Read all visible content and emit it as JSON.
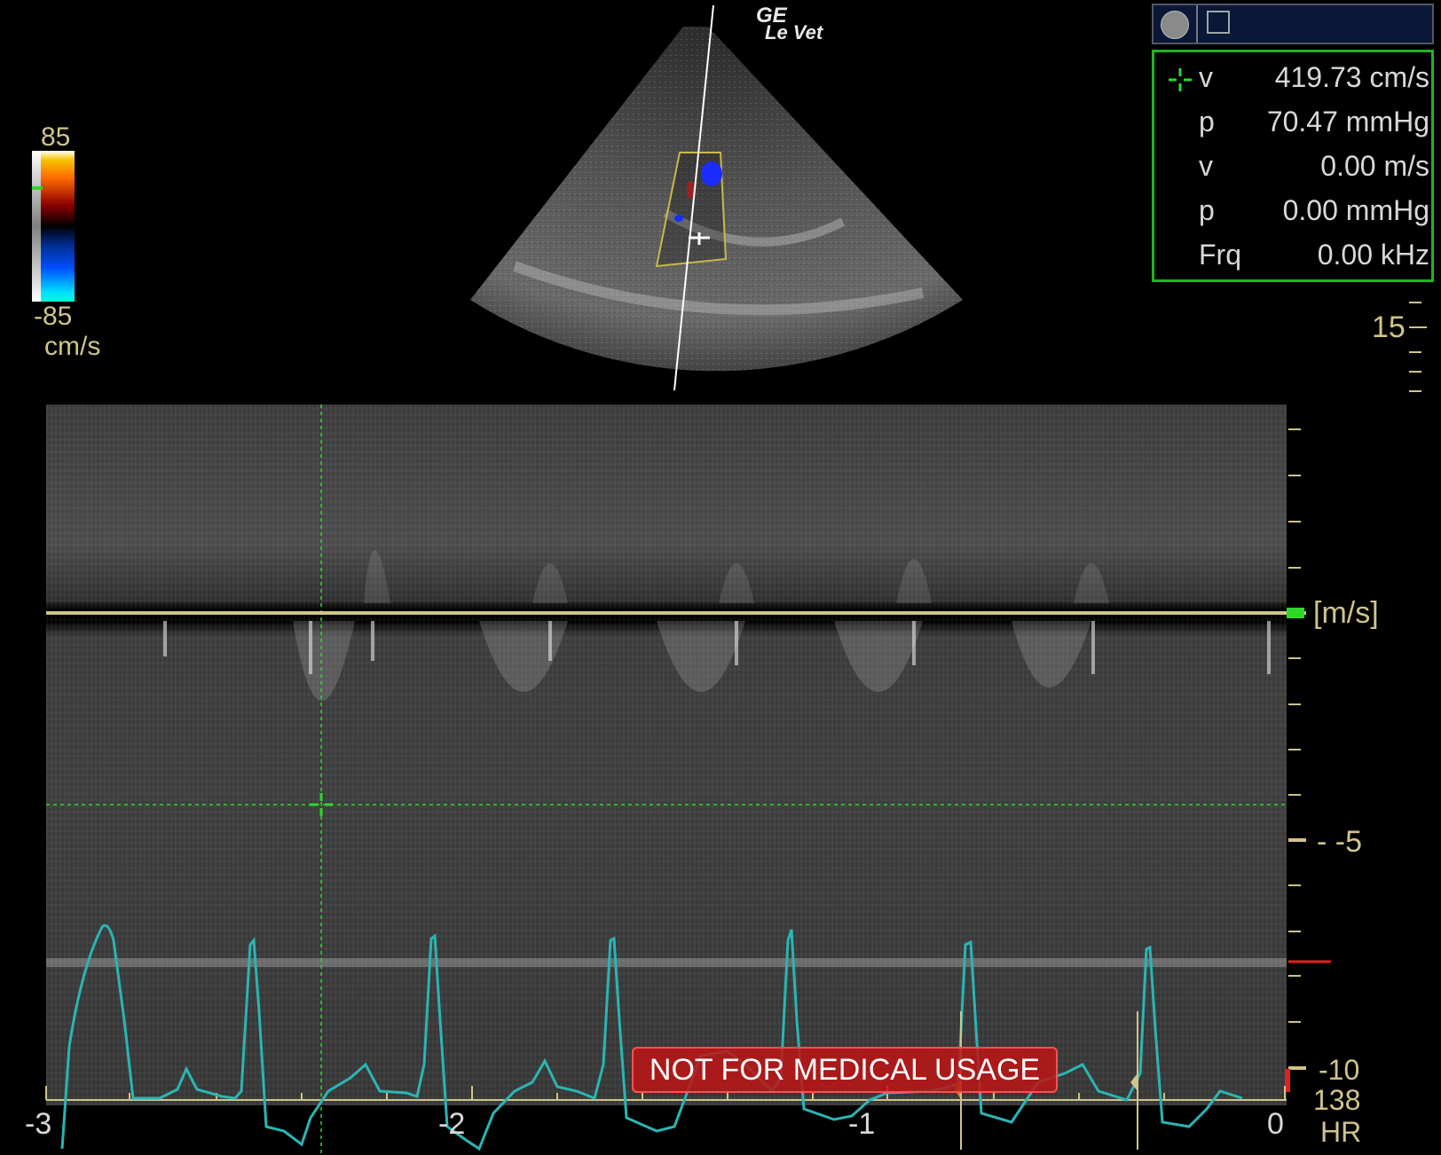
{
  "brand": {
    "name": "GE",
    "subtitle": "Le Vet"
  },
  "color_scale": {
    "max": "85",
    "min": "-85",
    "unit": "cm/s"
  },
  "measurement_panel": {
    "rows": [
      {
        "label": "v",
        "value": "419.73 cm/s"
      },
      {
        "label": "p",
        "value": "70.47 mmHg"
      },
      {
        "label": "v",
        "value": "0.00 m/s"
      },
      {
        "label": "p",
        "value": "0.00 mmHg"
      },
      {
        "label": "Frq",
        "value": "0.00 kHz"
      }
    ],
    "icons": [
      "record-circle-icon",
      "cursor-icon",
      "crosshair-icon"
    ]
  },
  "depth_scale": {
    "label": "15"
  },
  "doppler": {
    "unit": "[m/s]",
    "axis_labels": {
      "neg5": "- -5",
      "neg10": "-10"
    },
    "time_labels": [
      "-3",
      "-2",
      "-1",
      "0"
    ],
    "heart_rate": {
      "value": "138",
      "label": "HR"
    }
  },
  "warning": "NOT FOR MEDICAL USAGE",
  "colors": {
    "accent_green": "#2bd92b",
    "scale_yellow": "#cfc48a",
    "ecg": "#2ab5b5",
    "warning_red": "#be1414"
  }
}
